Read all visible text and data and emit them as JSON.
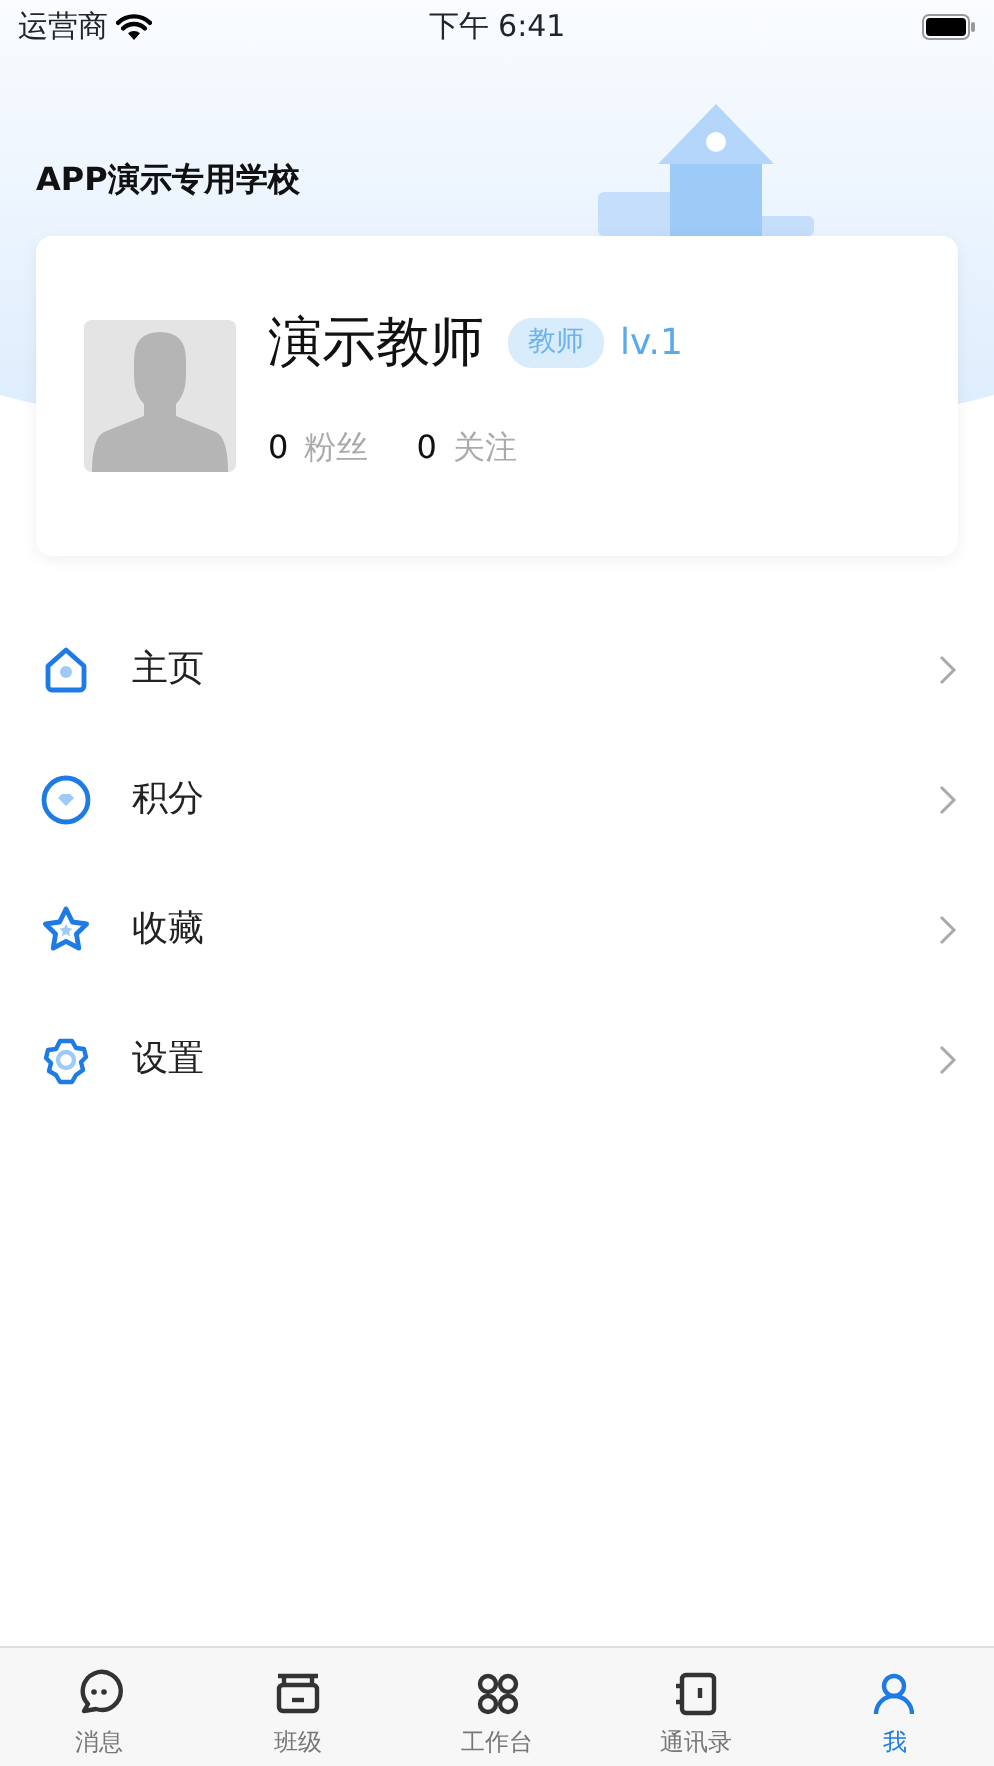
{
  "status_bar": {
    "carrier": "运营商",
    "time": "下午 6:41"
  },
  "school": "APP演示专用学校",
  "profile": {
    "name": "演示教师",
    "role": "教师",
    "level": "lv.1",
    "stats": [
      {
        "count": "0",
        "label": "粉丝"
      },
      {
        "count": "0",
        "label": "关注"
      }
    ]
  },
  "menu": [
    {
      "kind": "home",
      "label": "主页"
    },
    {
      "kind": "points",
      "label": "积分"
    },
    {
      "kind": "favorites",
      "label": "收藏"
    },
    {
      "kind": "settings",
      "label": "设置"
    }
  ],
  "tab_bar": [
    {
      "kind": "chat",
      "label": "消息",
      "selected": false
    },
    {
      "kind": "class",
      "label": "班级",
      "selected": false
    },
    {
      "kind": "grid",
      "label": "工作台",
      "selected": false
    },
    {
      "kind": "contacts",
      "label": "通讯录",
      "selected": false
    },
    {
      "kind": "me",
      "label": "我",
      "selected": true
    }
  ]
}
